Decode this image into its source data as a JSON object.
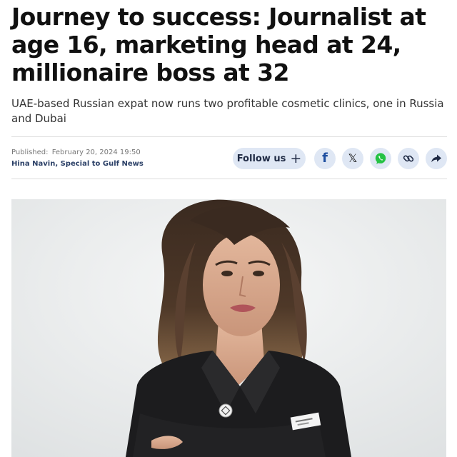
{
  "article": {
    "headline": "Journey to success: Journalist at age 16, marketing head at 24, millionaire boss at 32",
    "subheadline": "UAE-based Russian expat now runs two profitable cosmetic clinics, one in Russia and Dubai",
    "published_label": "Published:",
    "published_date": "February 20, 2024 19:50",
    "author": "Hina Navin, Special to Gulf News"
  },
  "actions": {
    "follow_label": "Follow us",
    "follow_icon": "plus-icon",
    "share_icons": [
      "facebook-icon",
      "x-icon",
      "whatsapp-icon",
      "link-icon",
      "share-arrow-icon"
    ]
  },
  "colors": {
    "button_bg": "#dfe7f4",
    "author": "#2a3f66",
    "facebook": "#1f4fa0",
    "whatsapp": "#25c244"
  },
  "image": {
    "subject": "portrait-photo"
  }
}
